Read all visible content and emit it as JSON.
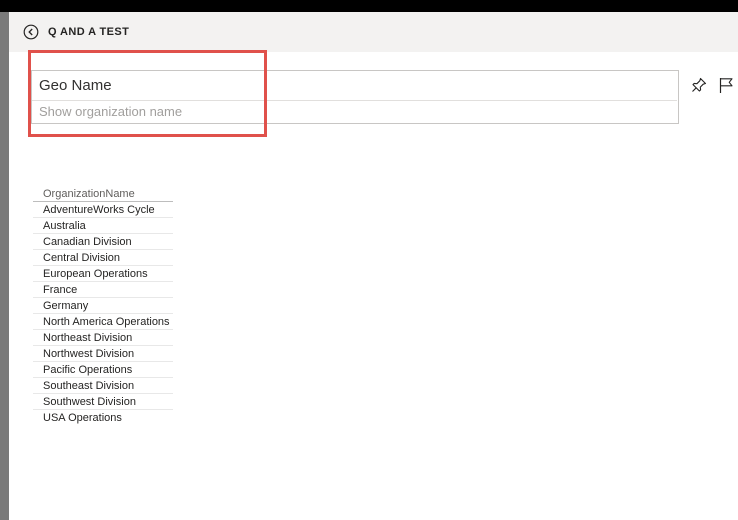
{
  "header": {
    "back_icon": "chevron-left-circle-icon",
    "title": "Q AND A TEST"
  },
  "qa": {
    "input_value": "Geo Name",
    "suggestion": "Show organization name"
  },
  "toolbar": {
    "pin_icon": "pin-icon",
    "flag_icon": "flag-icon"
  },
  "table": {
    "header": "OrganizationName",
    "rows": [
      "AdventureWorks Cycle",
      "Australia",
      "Canadian Division",
      "Central Division",
      "European Operations",
      "France",
      "Germany",
      "North America Operations",
      "Northeast Division",
      "Northwest Division",
      "Pacific Operations",
      "Southeast Division",
      "Southwest Division",
      "USA Operations"
    ]
  },
  "colors": {
    "highlight": "#e0514b",
    "header_bg": "#f3f2f1",
    "top_bar": "#000000"
  }
}
